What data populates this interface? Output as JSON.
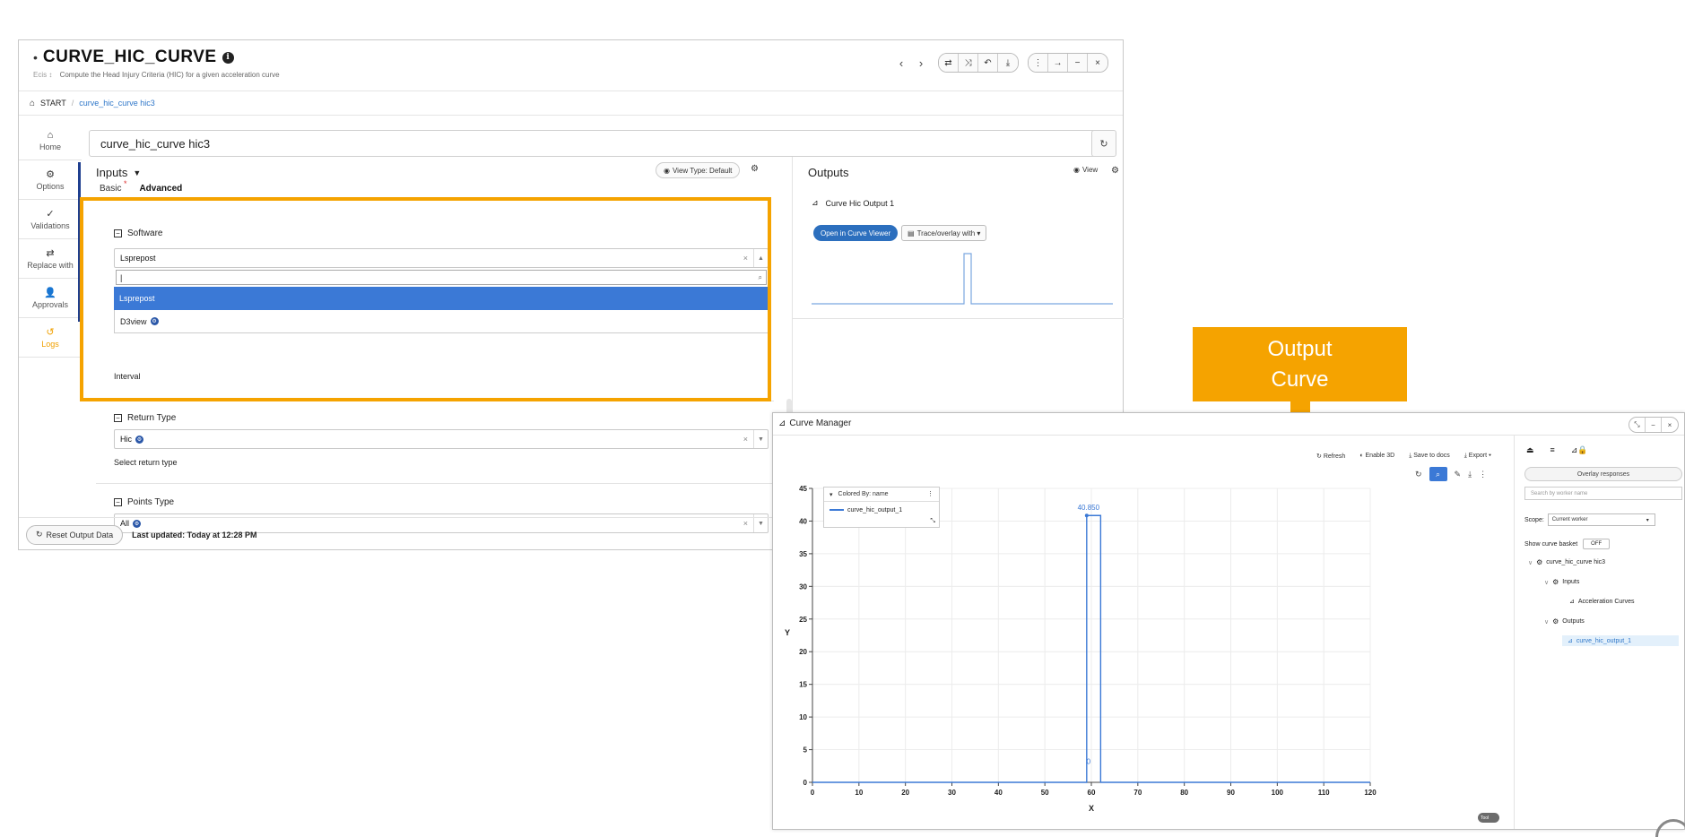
{
  "main": {
    "title": "CURVE_HIC_CURVE",
    "title_dot": "•",
    "subtitle_tag": "Ecis ↕",
    "subtitle": "Compute the Head Injury Criteria (HIC) for a given acceleration curve",
    "breadcrumb": {
      "start": "START",
      "sep": "/",
      "current": "curve_hic_curve hic3"
    },
    "nav": [
      {
        "label": "Home",
        "icon": "home-icon"
      },
      {
        "label": "Options",
        "icon": "gear-icon"
      },
      {
        "label": "Validations",
        "icon": "check-icon"
      },
      {
        "label": "Replace with",
        "icon": "swap-icon"
      },
      {
        "label": "Approvals",
        "icon": "user-check-icon"
      },
      {
        "label": "Logs",
        "icon": "history-icon"
      }
    ],
    "name_value": "curve_hic_curve hic3",
    "inputs_label": "Inputs",
    "view_type_label": "View Type: Default",
    "tabs": {
      "basic": "Basic",
      "required_mark": "*",
      "advanced": "Advanced"
    },
    "software": {
      "section": "Software",
      "selected": "Lsprepost",
      "search_value": "|",
      "options": [
        "Lsprepost",
        "D3view"
      ]
    },
    "interval_label": "Interval",
    "return_type": {
      "section": "Return Type",
      "selected": "Hic",
      "help": "Select return type"
    },
    "points_type": {
      "section": "Points Type",
      "selected": "All"
    },
    "reset_label": "Reset Output Data",
    "last_updated_prefix": "Last updated:",
    "last_updated_value": "Today at 12:28 PM",
    "outputs": {
      "label": "Outputs",
      "view_label": "View",
      "curve_name": "Curve Hic Output 1",
      "open_viewer": "Open in Curve Viewer",
      "trace_overlay": "Trace/overlay with ▾"
    }
  },
  "callout": {
    "line1": "Output",
    "line2": "Curve",
    "color": "#f5a300"
  },
  "curve_manager": {
    "title": "Curve Manager",
    "toolbar": [
      "Refresh",
      "Enable 3D",
      "Save to docs",
      "Export ▾"
    ],
    "legend_header": "Colored By: name",
    "legend_series": "curve_hic_output_1",
    "toggle_label": "Tool",
    "sidebar": {
      "overlay_label": "Overlay responses",
      "search_placeholder": "Search by worker name",
      "scope_label": "Scope:",
      "scope_value": "Current worker",
      "basket_label": "Show curve basket",
      "basket_state": "OFF",
      "tree": {
        "root": "curve_hic_curve hic3",
        "inputs": "Inputs",
        "input_curve": "Acceleration Curves",
        "outputs": "Outputs",
        "output_curve": "curve_hic_output_1"
      }
    }
  },
  "chart_data": {
    "type": "line",
    "title": "",
    "xlabel": "X",
    "ylabel": "Y",
    "xlim": [
      0,
      120
    ],
    "ylim": [
      0,
      45
    ],
    "xticks": [
      0,
      10,
      20,
      30,
      40,
      50,
      60,
      70,
      80,
      90,
      100,
      110,
      120
    ],
    "yticks": [
      0,
      5,
      10,
      15,
      20,
      25,
      30,
      35,
      40,
      45
    ],
    "grid": true,
    "legend_position": "top-left",
    "series": [
      {
        "name": "curve_hic_output_1",
        "color": "#3b79d6",
        "x": [
          0,
          59,
          59,
          62,
          62,
          120
        ],
        "y": [
          0,
          0,
          40.85,
          40.85,
          0,
          0
        ]
      }
    ],
    "annotations": [
      {
        "x": 59,
        "y": 40.85,
        "text": "40.850"
      },
      {
        "x": 59,
        "y": 2,
        "text": "0"
      }
    ]
  }
}
